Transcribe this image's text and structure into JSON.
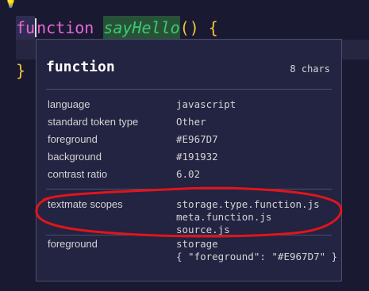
{
  "editor": {
    "lightbulb_icon": "lightbulb-icon",
    "code": {
      "keyword_part1": "fu",
      "keyword_part2": "nction",
      "function_name": "sayHello",
      "parens": "()",
      "open_brace": "{",
      "close_brace": "}"
    }
  },
  "hover": {
    "title": "function",
    "chars": "8 chars",
    "rows": [
      {
        "label": "language",
        "value": "javascript"
      },
      {
        "label": "standard token type",
        "value": "Other"
      },
      {
        "label": "foreground",
        "value": "#E967D7"
      },
      {
        "label": "background",
        "value": "#191932"
      },
      {
        "label": "contrast ratio",
        "value": "6.02"
      }
    ],
    "textmate": {
      "label": "textmate scopes",
      "scopes": [
        "storage.type.function.js",
        "meta.function.js",
        "source.js"
      ]
    },
    "theme_rule": {
      "label": "foreground",
      "selector": "storage",
      "rule": "{ \"foreground\": \"#E967D7\" }"
    }
  },
  "colors": {
    "editor_background": "#191932",
    "keyword": "#E967D7",
    "function_name": "#3DC96F",
    "brace": "#F0C43A",
    "annotation": "#E0151B"
  }
}
